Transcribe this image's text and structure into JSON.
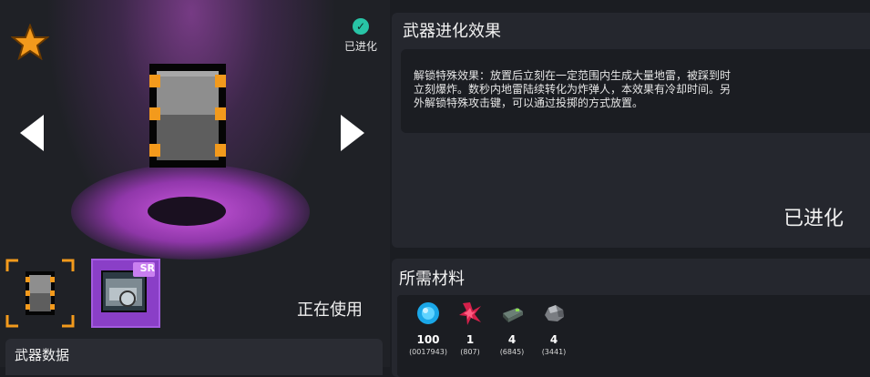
{
  "header": {
    "evolved_badge_text": "已进化"
  },
  "weapon_preview": {
    "in_use_text": "正在使用",
    "data_tab_label": "武器数据",
    "slot2_rarity": "SR"
  },
  "evolution": {
    "title": "武器进化效果",
    "description_lines": [
      "解锁特殊效果：放置后立刻在一定范围内生成大量地雷，被踩到时",
      "立刻爆炸。数秒内地雷陆续转化为炸弹人，本效果有冷却时间。另",
      "外解锁特殊攻击键，可以通过投掷的方式放置。"
    ],
    "status": "已进化"
  },
  "materials": {
    "title": "所需材料",
    "items": [
      {
        "icon": "blue-gem-icon",
        "count": "100",
        "owned": "(0017943)"
      },
      {
        "icon": "red-crystal-icon",
        "count": "1",
        "owned": "(807)"
      },
      {
        "icon": "battery-part-icon",
        "count": "4",
        "owned": "(6845)"
      },
      {
        "icon": "ore-chunk-icon",
        "count": "4",
        "owned": "(3441)"
      }
    ]
  },
  "colors": {
    "accent_purple": "#b64fd6",
    "star_orange": "#f39a1c",
    "evolved_green": "#28c4a6"
  }
}
